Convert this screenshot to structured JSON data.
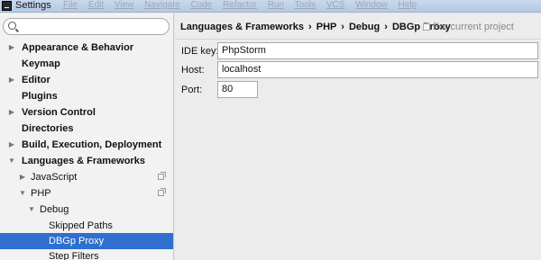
{
  "window": {
    "title": "Settings",
    "menu_ghost": [
      "File",
      "Edit",
      "View",
      "Navigate",
      "Code",
      "Refactor",
      "Run",
      "Tools",
      "VCS",
      "Window",
      "Help"
    ]
  },
  "sidebar": {
    "search": {
      "value": "",
      "placeholder": ""
    },
    "items": [
      {
        "label": "Appearance & Behavior",
        "arrow": "▶"
      },
      {
        "label": "Keymap",
        "arrow": ""
      },
      {
        "label": "Editor",
        "arrow": "▶"
      },
      {
        "label": "Plugins",
        "arrow": ""
      },
      {
        "label": "Version Control",
        "arrow": "▶"
      },
      {
        "label": "Directories",
        "arrow": ""
      },
      {
        "label": "Build, Execution, Deployment",
        "arrow": "▶"
      },
      {
        "label": "Languages & Frameworks",
        "arrow": "▼"
      },
      {
        "label": "JavaScript",
        "arrow": "▶"
      },
      {
        "label": "PHP",
        "arrow": "▼"
      },
      {
        "label": "Debug",
        "arrow": "▼"
      },
      {
        "label": "Skipped Paths",
        "arrow": ""
      },
      {
        "label": "DBGp Proxy",
        "arrow": ""
      },
      {
        "label": "Step Filters",
        "arrow": ""
      }
    ]
  },
  "main": {
    "breadcrumb": [
      "Languages & Frameworks",
      "PHP",
      "Debug",
      "DBGp Proxy"
    ],
    "breadcrumb_sep": "›",
    "scope_note": "For current project",
    "fields": {
      "ide_key": {
        "label": "IDE key:",
        "value": "PhpStorm"
      },
      "host": {
        "label": "Host:",
        "value": "localhost"
      },
      "port": {
        "label": "Port:",
        "value": "80"
      }
    }
  },
  "colors": {
    "selection": "#2e6fd0",
    "sidebar_bg": "#f2f2f2",
    "panel_bg": "#ececec"
  }
}
